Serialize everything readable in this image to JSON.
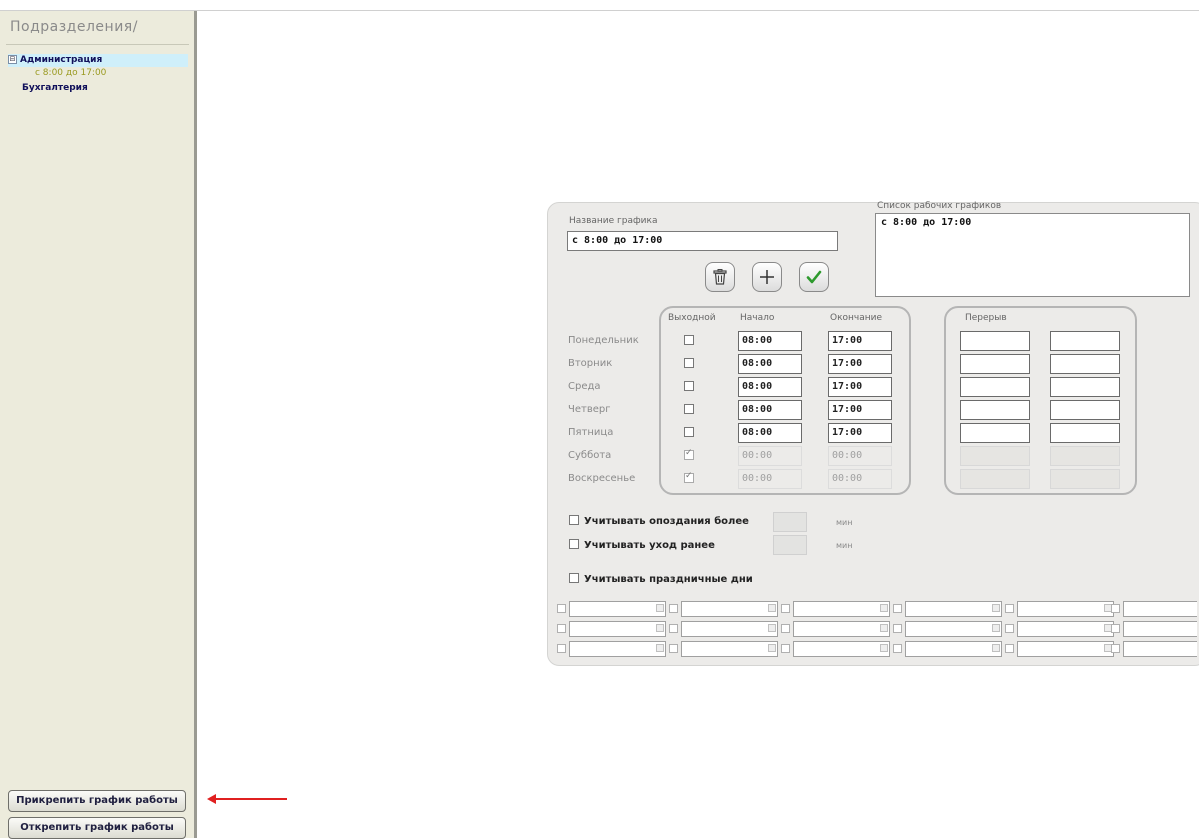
{
  "sidebar": {
    "title": "Подразделения/",
    "tree": [
      {
        "toggle": "⊟",
        "label": "Администрация",
        "children": [
          "с 8:00 до 17:00"
        ]
      },
      {
        "label": "Бухгалтерия"
      }
    ],
    "attach_button": "Прикрепить график работы",
    "detach_button": "Открепить график работы"
  },
  "schedule": {
    "name_label": "Название графика",
    "name_value": "с 8:00 до 17:00",
    "list_label": "Список рабочих графиков",
    "list_items": [
      "с 8:00 до 17:00"
    ],
    "columns": {
      "dayoff": "Выходной",
      "start": "Начало",
      "end": "Окончание",
      "break": "Перерыв"
    },
    "days": [
      {
        "name": "Понедельник",
        "dayoff": false,
        "start": "08:00",
        "end": "17:00"
      },
      {
        "name": "Вторник",
        "dayoff": false,
        "start": "08:00",
        "end": "17:00"
      },
      {
        "name": "Среда",
        "dayoff": false,
        "start": "08:00",
        "end": "17:00"
      },
      {
        "name": "Четверг",
        "dayoff": false,
        "start": "08:00",
        "end": "17:00"
      },
      {
        "name": "Пятница",
        "dayoff": false,
        "start": "08:00",
        "end": "17:00"
      },
      {
        "name": "Суббота",
        "dayoff": true,
        "start": "00:00",
        "end": "00:00"
      },
      {
        "name": "Воскресенье",
        "dayoff": true,
        "start": "00:00",
        "end": "00:00"
      }
    ],
    "options": {
      "late_label": "Учитывать опоздания более",
      "early_label": "Учитывать уход ранее",
      "unit": "мин",
      "holidays_label": "Учитывать праздничные дни"
    },
    "icons": {
      "delete": "trash-icon",
      "add": "plus-icon",
      "save": "checkmark-icon"
    },
    "colors": {
      "save_check": "#2e9a2e",
      "annotation_arrow": "#e02020",
      "tree_selected": "#cfeffa"
    }
  }
}
